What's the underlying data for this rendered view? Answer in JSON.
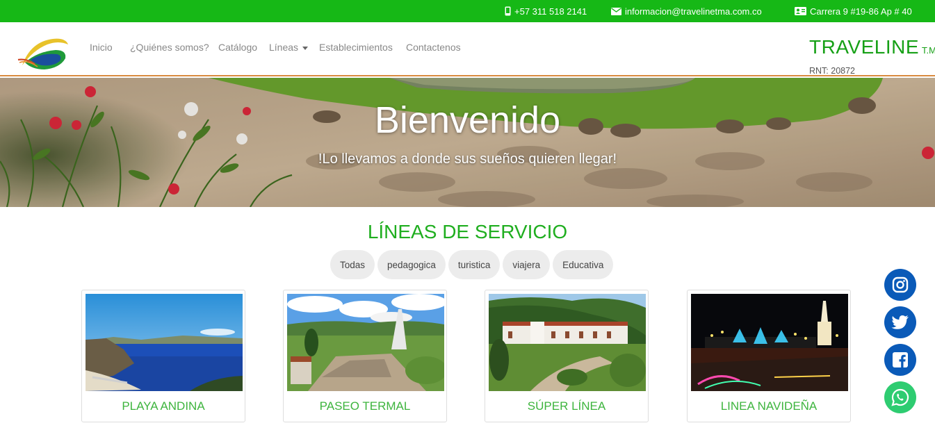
{
  "topbar": {
    "phone": "+57 311 518 2141",
    "email": "informacion@travelinetma.com.co",
    "address": "Carrera 9 #19-86 Ap # 40"
  },
  "nav": {
    "items": [
      "Inicio",
      "¿Quiénes somos?",
      "Catálogo",
      "Líneas",
      "Establecimientos",
      "Contactenos"
    ],
    "brand_name": "TRAVELINE",
    "brand_suffix": "T.M.A",
    "rnt": "RNT: 20872"
  },
  "hero": {
    "title": "Bienvenido",
    "subtitle": "!Lo llevamos a donde sus sueños quieren llegar!"
  },
  "services": {
    "title": "LÍNEAS DE SERVICIO",
    "filters": [
      "Todas",
      "pedagogica",
      "turistica",
      "viajera",
      "Educativa"
    ],
    "cards": [
      {
        "label": "PLAYA ANDINA"
      },
      {
        "label": "PASEO TERMAL"
      },
      {
        "label": "SÚPER LÍNEA"
      },
      {
        "label": "LINEA NAVIDEÑA"
      }
    ]
  },
  "social": [
    "instagram-icon",
    "twitter-icon",
    "facebook-icon",
    "whatsapp-icon"
  ],
  "colors": {
    "topbar_green": "#16b816",
    "brand_green": "#16a016",
    "section_green": "#1fae1f",
    "social_blue": "#0a5ab8",
    "whatsapp_green": "#2ecc71"
  }
}
